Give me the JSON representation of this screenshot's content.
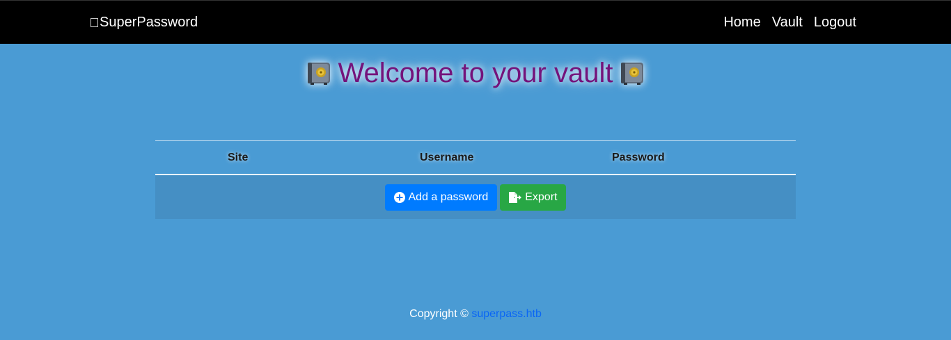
{
  "navbar": {
    "brand": "SuperPassword",
    "links": [
      "Home",
      "Vault",
      "Logout"
    ]
  },
  "page": {
    "title": "Welcome to your vault"
  },
  "table": {
    "headers": [
      "Site",
      "Username",
      "Password"
    ]
  },
  "actions": {
    "add_label": "Add a password",
    "export_label": "Export"
  },
  "footer": {
    "copyright": "Copyright ©",
    "link_text": "superpass.htb"
  },
  "colors": {
    "background": "#4a9bd4",
    "navbar": "#000000",
    "title": "#74137b",
    "primary": "#007bff",
    "success": "#28a745",
    "link": "#0a66f5"
  }
}
